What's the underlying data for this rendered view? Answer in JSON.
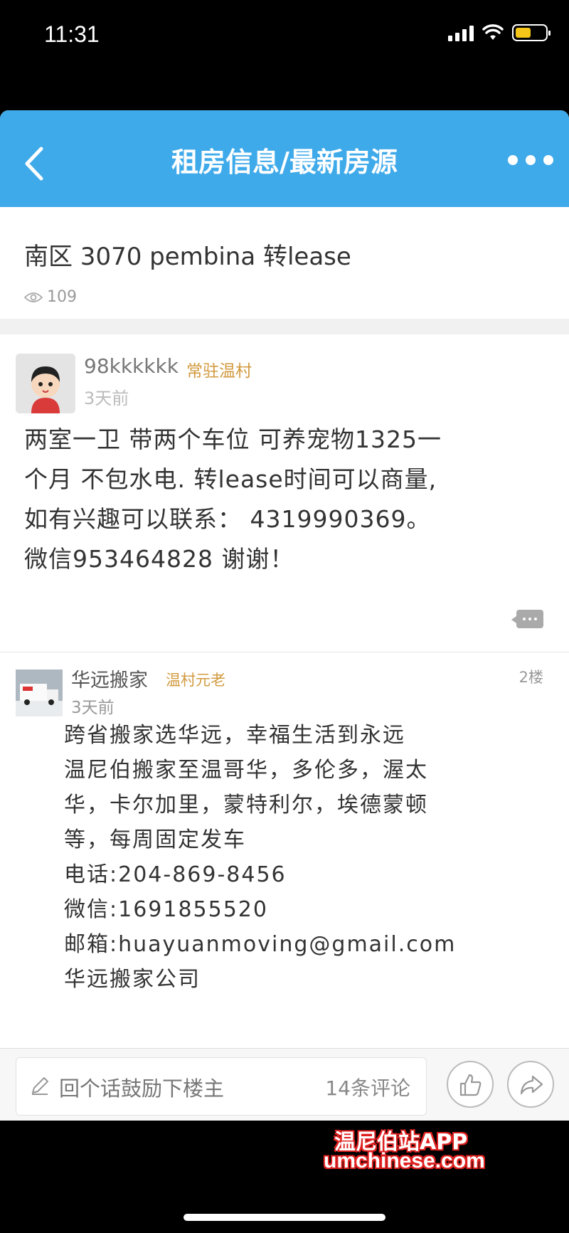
{
  "status_bar": {
    "time": "11:31"
  },
  "nav": {
    "title": "租房信息/最新房源"
  },
  "post": {
    "title": "南区 3070 pembina 转lease",
    "views": "109"
  },
  "floor1": {
    "username": "98kkkkkk",
    "badge": "常驻温村",
    "time": "3天前",
    "lines": [
      "两室一卫 带两个车位 可养宠物1325一",
      "个月 不包水电. 转lease时间可以商量,",
      "如有兴趣可以联系： 4319990369。",
      "微信953464828 谢谢！"
    ]
  },
  "floor2": {
    "username": "华远搬家",
    "badge": "温村元老",
    "floor_number": "2楼",
    "time": "3天前",
    "lines": [
      "跨省搬家选华远，幸福生活到永远",
      "温尼伯搬家至温哥华，多伦多，渥太",
      "华，卡尔加里，蒙特利尔，埃德蒙顿",
      "等，每周固定发车",
      "电话:204-869-8456",
      "微信:1691855520",
      "邮箱:huayuanmoving@gmail.com",
      "华远搬家公司"
    ]
  },
  "bottom_bar": {
    "reply_placeholder": "回个话鼓励下楼主",
    "comment_count": "14条评论"
  },
  "watermark": {
    "line1": "温尼伯站APP",
    "line2": "umchinese.com"
  },
  "icons": {
    "back": "back-arrow-icon",
    "more": "more-dots-icon",
    "eye": "eye-icon",
    "comment": "comment-bubble-icon",
    "pencil": "pencil-icon",
    "like": "thumbs-up-icon",
    "share": "share-arrow-icon"
  },
  "colors": {
    "nav_bg": "#3faaea",
    "badge": "#d19a3f",
    "watermark_outline": "#e02020"
  }
}
